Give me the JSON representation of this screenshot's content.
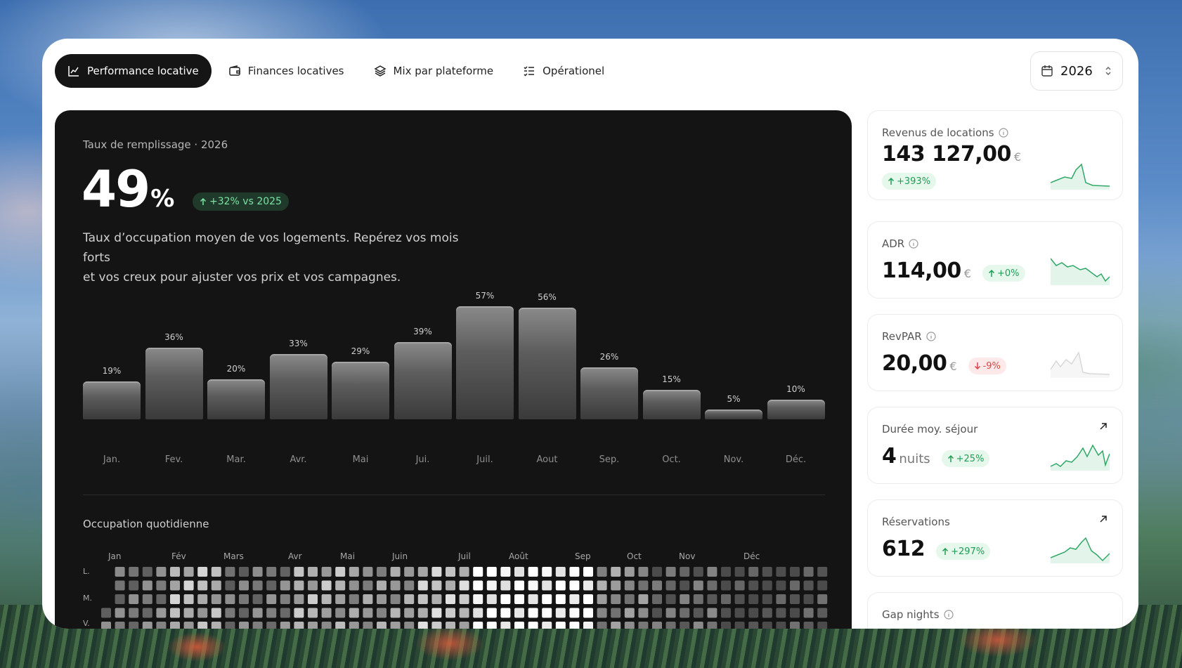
{
  "nav": {
    "tabs": [
      {
        "label": "Performance locative",
        "icon": "line-chart-icon",
        "active": true
      },
      {
        "label": "Finances locatives",
        "icon": "wallet-icon",
        "active": false
      },
      {
        "label": "Mix par plateforme",
        "icon": "layers-icon",
        "active": false
      },
      {
        "label": "Opérationel",
        "icon": "checklist-icon",
        "active": false
      }
    ],
    "year": "2026"
  },
  "occupancy": {
    "subtitle": "Taux de remplissage · 2026",
    "value": "49",
    "unit": "%",
    "delta": "+32% vs 2025",
    "description_line1": "Taux d’occupation moyen de vos logements. Repérez vos mois forts",
    "description_line2": "et vos creux pour ajuster vos prix et vos campagnes."
  },
  "chart_data": {
    "type": "bar",
    "categories": [
      "Jan.",
      "Fev.",
      "Mar.",
      "Avr.",
      "Mai",
      "Jui.",
      "Juil.",
      "Aout",
      "Sep.",
      "Oct.",
      "Nov.",
      "Déc."
    ],
    "values": [
      19,
      36,
      20,
      33,
      29,
      39,
      57,
      56,
      26,
      15,
      5,
      10
    ],
    "data_labels": [
      "19%",
      "36%",
      "20%",
      "33%",
      "29%",
      "39%",
      "57%",
      "56%",
      "26%",
      "15%",
      "5%",
      "10%"
    ],
    "title": "Taux de remplissage · 2026",
    "ylim": [
      0,
      60
    ],
    "grid": false
  },
  "daily": {
    "title": "Occupation quotidienne",
    "months": [
      "Jan",
      "Fév",
      "Mars",
      "Avr",
      "Mai",
      "Juin",
      "Juil",
      "Août",
      "Sep",
      "Oct",
      "Nov",
      "Déc"
    ],
    "day_labels": [
      "L.",
      "M.",
      "V."
    ]
  },
  "kpis": [
    {
      "title": "Revenus de locations",
      "value": "143 127,00",
      "unit": "€",
      "delta": "+393%",
      "direction": "up",
      "icon": "info-icon"
    },
    {
      "title": "ADR",
      "value": "114,00",
      "unit": "€",
      "delta": "+0%",
      "direction": "up",
      "icon": "info-icon"
    },
    {
      "title": "RevPAR",
      "value": "20,00",
      "unit": "€",
      "delta": "-9%",
      "direction": "down",
      "icon": "info-icon"
    },
    {
      "title": "Durée moy. séjour",
      "value": "4",
      "unit": "nuits",
      "delta": "+25%",
      "direction": "up",
      "icon": "arrow-up-right-icon"
    },
    {
      "title": "Réservations",
      "value": "612",
      "unit": "",
      "delta": "+297%",
      "direction": "up",
      "icon": "arrow-up-right-icon"
    },
    {
      "title": "Gap nights",
      "icon": "info-icon"
    }
  ],
  "colors": {
    "panel_bg": "#141414",
    "accent_up": "#1f9d55",
    "accent_down": "#d94545",
    "active_tab": "#151515"
  }
}
